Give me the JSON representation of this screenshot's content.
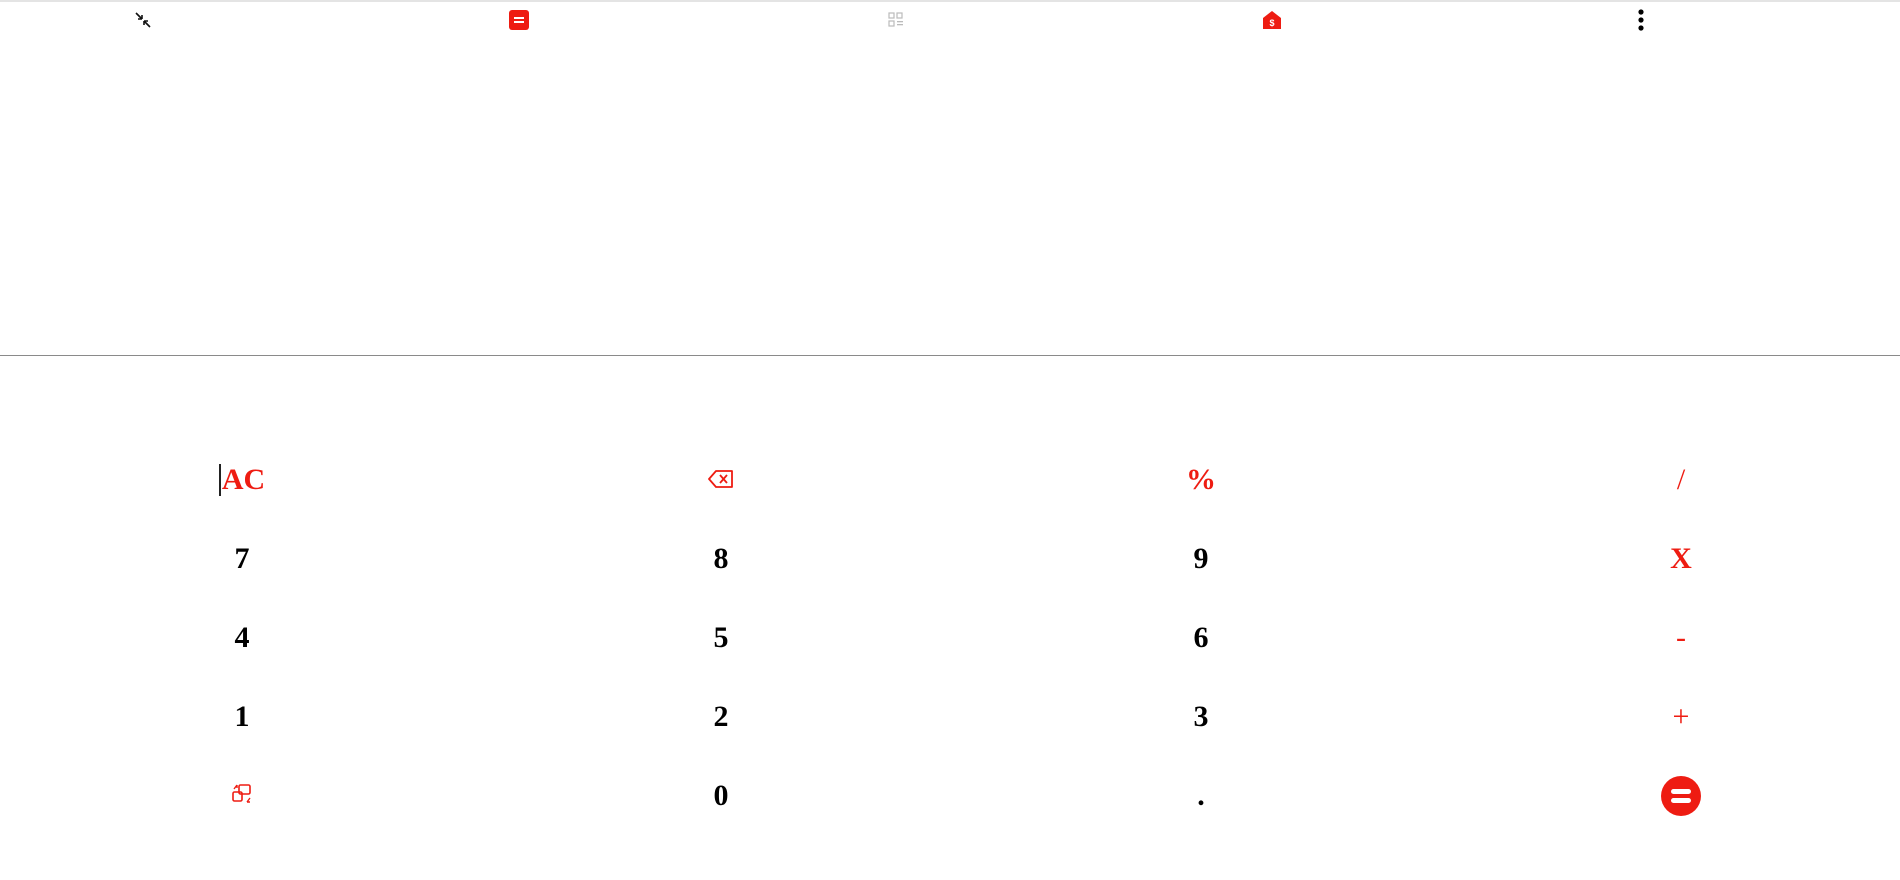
{
  "toolbar": {
    "icons": [
      "collapse-icon",
      "calculator-icon",
      "qr-code-icon",
      "currency-home-icon",
      "more-vert-icon"
    ],
    "accent_color": "#ee1c12"
  },
  "display": {
    "expression": "",
    "result": ""
  },
  "keypad": {
    "row1": [
      "AC",
      "backspace-icon",
      "%",
      "/"
    ],
    "row2": [
      "7",
      "8",
      "9",
      "X"
    ],
    "row3": [
      "4",
      "5",
      "6",
      "-"
    ],
    "row4": [
      "1",
      "2",
      "3",
      "+"
    ],
    "row5": [
      "converter-icon",
      "0",
      ".",
      "equals-icon"
    ],
    "labels": {
      "ac": "AC",
      "percent": "%",
      "divide": "/",
      "seven": "7",
      "eight": "8",
      "nine": "9",
      "multiply": "X",
      "four": "4",
      "five": "5",
      "six": "6",
      "minus": "-",
      "one": "1",
      "two": "2",
      "three": "3",
      "plus": "+",
      "zero": "0",
      "decimal": "."
    },
    "operator_color": "#ee1c12",
    "digit_color": "#000000"
  }
}
